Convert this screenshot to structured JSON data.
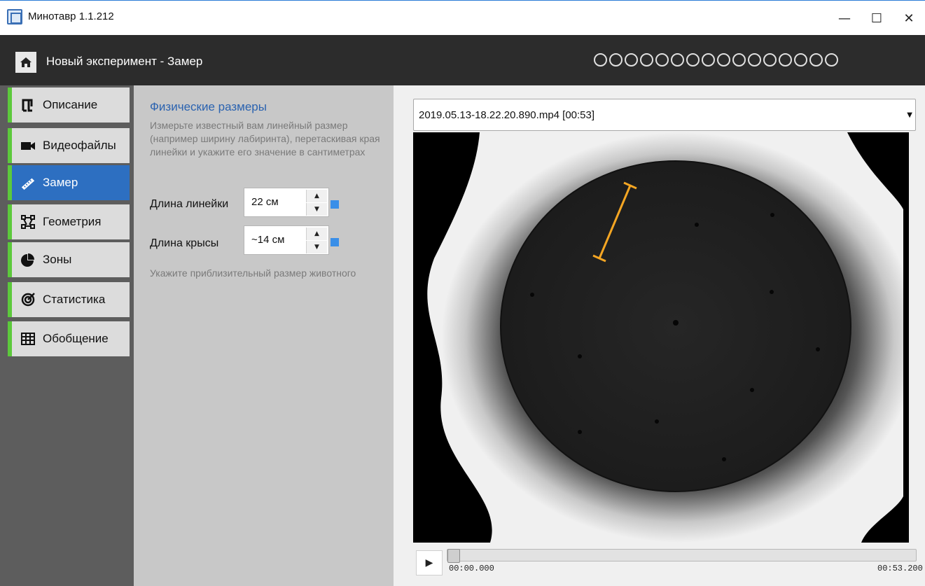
{
  "window": {
    "title": "Минотавр 1.1.212",
    "minimize_glyph": "—",
    "maximize_glyph": "☐",
    "close_glyph": "✕"
  },
  "header": {
    "title": "Новый эксперимент - Замер",
    "home_icon": "home-icon",
    "step_count": 16
  },
  "sidebar": {
    "items": [
      {
        "label": "Описание",
        "icon": "description-icon",
        "active": false
      },
      {
        "label": "Видеофайлы",
        "icon": "video-camera-icon",
        "active": false
      },
      {
        "label": "Замер",
        "icon": "ruler-icon",
        "active": true
      },
      {
        "label": "Геометрия",
        "icon": "geometry-icon",
        "active": false
      },
      {
        "label": "Зоны",
        "icon": "pie-chart-icon",
        "active": false
      },
      {
        "label": "Статистика",
        "icon": "statistics-icon",
        "active": false
      },
      {
        "label": "Обобщение",
        "icon": "table-icon",
        "active": false
      }
    ]
  },
  "measure": {
    "section_title": "Физические размеры",
    "description": "Измерьте известный вам линейный размер (например ширину лабиринта), перетаскивая края линейки и укажите его значение в сантиметрах",
    "ruler_length_label": "Длина линейки",
    "ruler_length_value": "22 см",
    "rat_length_label": "Длина крысы",
    "rat_length_value": "~14 см",
    "hint": "Укажите приблизительный размер животного"
  },
  "video": {
    "file": "2019.05.13-18.22.20.890.mp4 [00:53]",
    "time_start": "00:00.000",
    "time_end": "00:53.200",
    "position_fraction": 0.0,
    "ruler_color": "#f5a623"
  },
  "colors": {
    "accent": "#2d6fc1",
    "nav_indicator": "#5cc93c",
    "spin_mark": "#3a8fe8"
  }
}
